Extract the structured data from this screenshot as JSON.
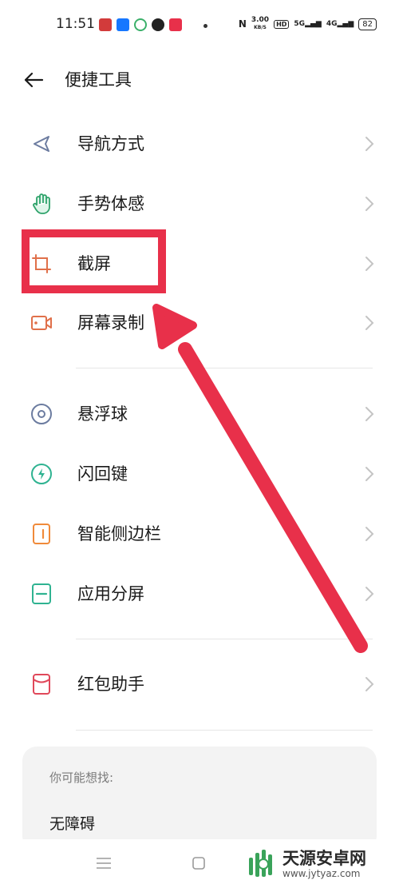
{
  "status_bar": {
    "time": "11:51",
    "net_speed_value": "3.00",
    "net_speed_unit": "KB/S",
    "hd_badge": "HD",
    "signal_1": "5G",
    "signal_2": "4G",
    "battery": "82"
  },
  "header": {
    "title": "便捷工具"
  },
  "menu": {
    "items": [
      {
        "label": "导航方式",
        "icon": "navigation-arrow-icon"
      },
      {
        "label": "手势体感",
        "icon": "hand-gesture-icon"
      },
      {
        "label": "截屏",
        "icon": "crop-screenshot-icon"
      },
      {
        "label": "屏幕录制",
        "icon": "screen-record-icon"
      },
      {
        "label": "悬浮球",
        "icon": "floating-ball-icon"
      },
      {
        "label": "闪回键",
        "icon": "flashback-key-icon"
      },
      {
        "label": "智能侧边栏",
        "icon": "smart-sidebar-icon"
      },
      {
        "label": "应用分屏",
        "icon": "split-screen-icon"
      },
      {
        "label": "红包助手",
        "icon": "red-envelope-icon"
      }
    ]
  },
  "suggestions": {
    "title": "你可能想找:",
    "items": [
      "无障碍"
    ]
  },
  "watermark": {
    "name": "天源安卓网",
    "url": "www.jytyaz.com"
  },
  "colors": {
    "highlight": "#e8304a",
    "chevron": "#c4c4c4",
    "card_bg": "#f3f3f3"
  }
}
